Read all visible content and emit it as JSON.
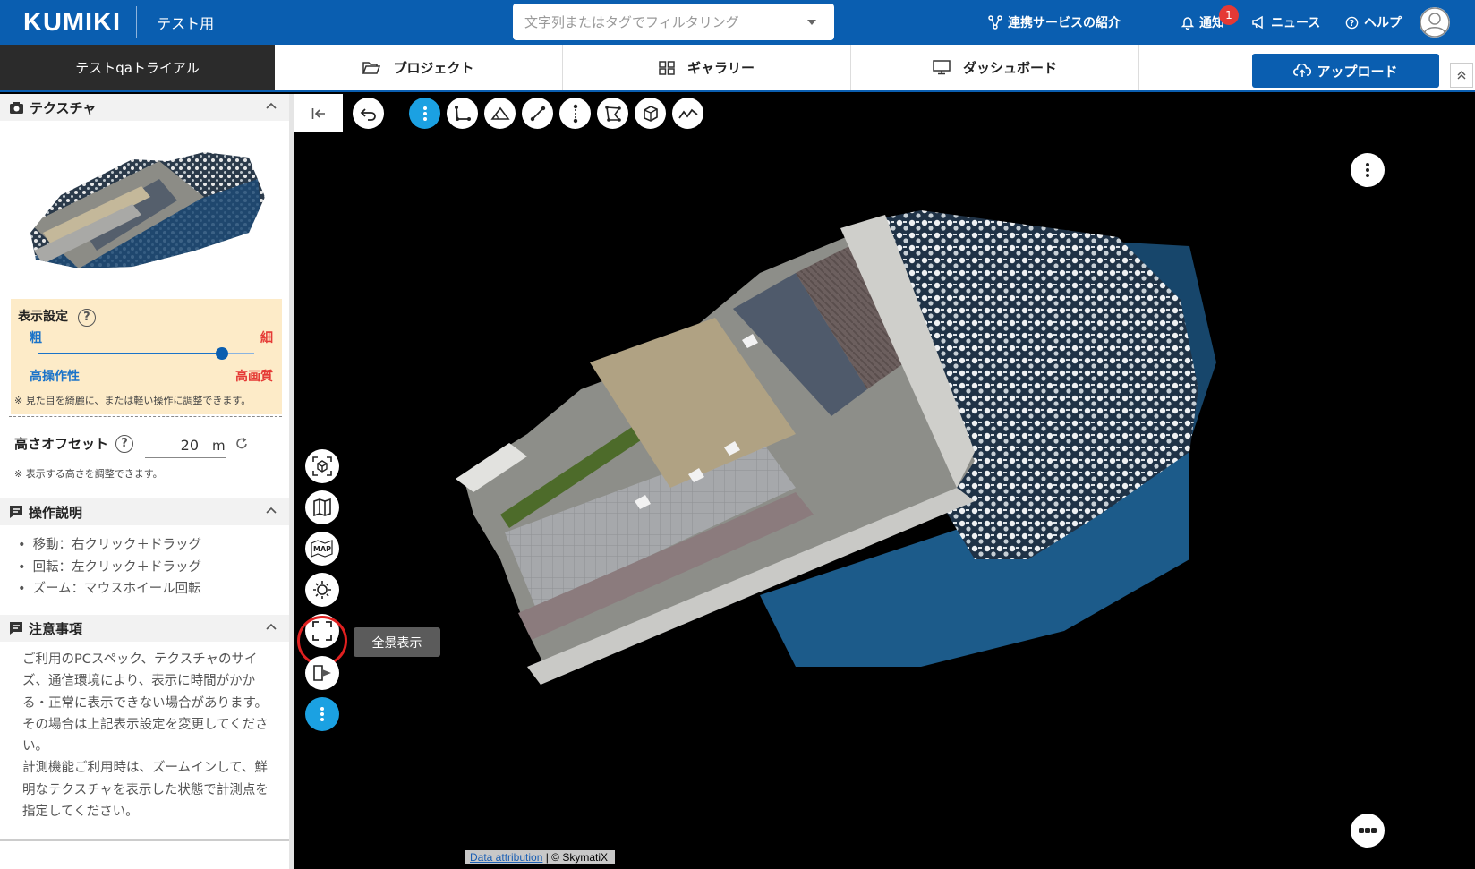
{
  "header": {
    "logo": "KUMIKI",
    "org": "テスト用",
    "search_placeholder": "文字列またはタグでフィルタリング",
    "nav": {
      "services": "連携サービスの紹介",
      "notifications": "通知",
      "notification_count": "1",
      "news": "ニュース",
      "help": "ヘルプ"
    }
  },
  "tabbar": {
    "project_name": "テストqaトライアル",
    "tabs": [
      "プロジェクト",
      "ギャラリー",
      "ダッシュボード"
    ],
    "upload": "アップロード"
  },
  "panel": {
    "texture_title": "テクスチャ",
    "display": {
      "title": "表示設定",
      "help": "?",
      "coarse": "粗",
      "fine": "細",
      "performance": "高操作性",
      "quality": "高画質",
      "level": 0.85,
      "note": "※ 見た目を綺麗に、または軽い操作に調整できます。"
    },
    "height": {
      "label": "高さオフセット",
      "help": "?",
      "value": "20",
      "unit": "m",
      "note": "※ 表示する高さを調整できます。"
    },
    "operations": {
      "title": "操作説明",
      "items": [
        "移動：右クリック＋ドラッグ",
        "回転：左クリック＋ドラッグ",
        "ズーム：マウスホイール回転"
      ]
    },
    "caution": {
      "title": "注意事項",
      "text": "ご利用のPCスペック、テクスチャのサイズ、通信環境により、表示に時間がかかる・正常に表示できない場合があります。その場合は上記表示設定を変更してください。\n計測機能ご利用時は、ズームインして、鮮明なテクスチャを表示した状態で計測点を指定してください。"
    }
  },
  "viewer": {
    "map_label": "MAP",
    "tooltip": "全景表示",
    "attribution_link": "Data attribution",
    "attribution_text": " | © SkymatiX"
  },
  "colors": {
    "brand": "#0a5eb0",
    "active_tool": "#1ba1e2",
    "highlight_ring": "#e02020",
    "badge": "#e53935",
    "settings_bg": "#fdebc8"
  }
}
